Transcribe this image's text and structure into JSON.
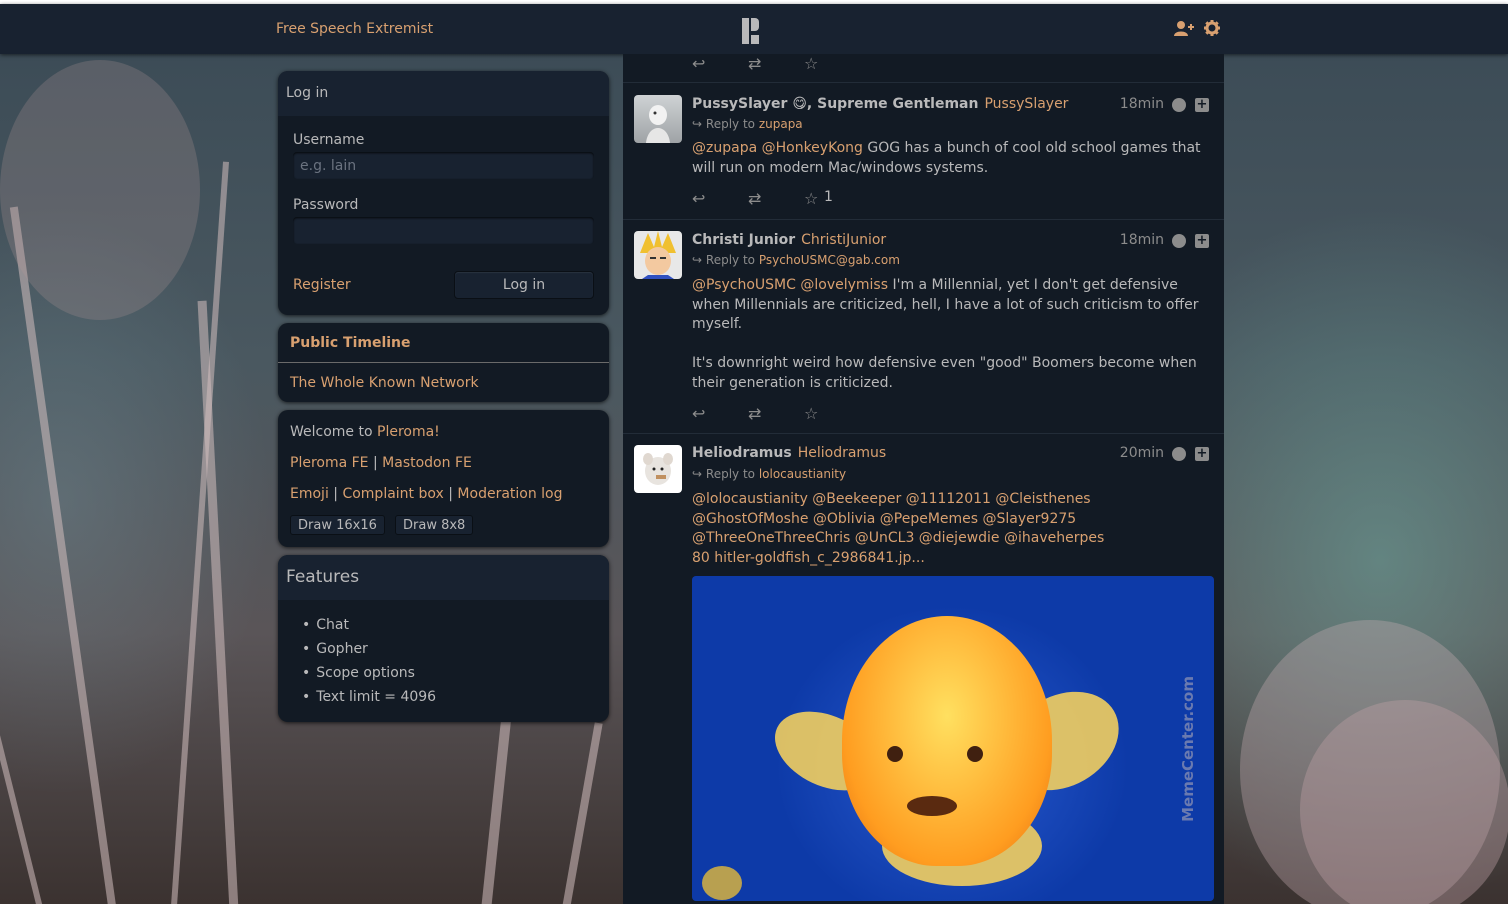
{
  "navbar": {
    "site_title": "Free Speech Extremist",
    "icons": [
      "user-plus-icon",
      "gear-icon"
    ]
  },
  "login": {
    "heading": "Log in",
    "username_label": "Username",
    "username_placeholder": "e.g. lain",
    "password_label": "Password",
    "password_value": "",
    "register_label": "Register",
    "login_button": "Log in"
  },
  "nav": {
    "public_timeline": "Public Timeline",
    "whole_network": "The Whole Known Network"
  },
  "instance": {
    "welcome_prefix": "Welcome to ",
    "welcome_link": "Pleroma!",
    "links1": [
      "Pleroma FE",
      "Mastodon FE"
    ],
    "links2": [
      "Emoji",
      "Complaint box",
      "Moderation log"
    ],
    "separator": " | ",
    "buttons": [
      "Draw 16x16",
      "Draw 8x8"
    ]
  },
  "features": {
    "heading": "Features",
    "items": [
      "Chat",
      "Gopher",
      "Scope options",
      "Text limit = 4096"
    ]
  },
  "timeline": {
    "posts": [
      {
        "name": "PussySlayer 😋, Supreme Gentleman",
        "acct": "PussySlayer",
        "time": "18min",
        "reply_prefix": "Reply to ",
        "reply_to": "zupapa",
        "mentions": [
          "@zupapa",
          "@HonkeyKong"
        ],
        "text": " GOG has a bunch of cool old school games that will run on modern Mac/windows systems.",
        "fav_count": "1"
      },
      {
        "name": "Christi Junior",
        "acct": "ChristiJunior",
        "time": "18min",
        "reply_prefix": "Reply to ",
        "reply_to": "PsychoUSMC@gab.com",
        "mentions": [
          "@PsychoUSMC",
          "@lovelymiss"
        ],
        "text": " I'm a Millennial, yet I don't get defensive when Millennials are criticized, hell, I have a lot of such criticism to offer myself.",
        "text2": "It's downright weird how defensive even \"good\" Boomers become when their generation is criticized."
      },
      {
        "name": "Heliodramus",
        "acct": "Heliodramus",
        "time": "20min",
        "reply_prefix": "Reply to ",
        "reply_to": "lolocaustianity",
        "mentions_line1": "@lolocaustianity @Beekeeper @11112011 @Cleisthenes",
        "mentions_line2": "@GhostOfMoshe @Oblivia @PepeMemes @Slayer9275",
        "mentions_line3": "@ThreeOneThreeChris @UnCL3 @diejewdie @ihaveherpes",
        "attachment_link": "80 hitler-goldfish_c_2986841.jp...",
        "watermark": "MemeCenter.com"
      }
    ]
  }
}
